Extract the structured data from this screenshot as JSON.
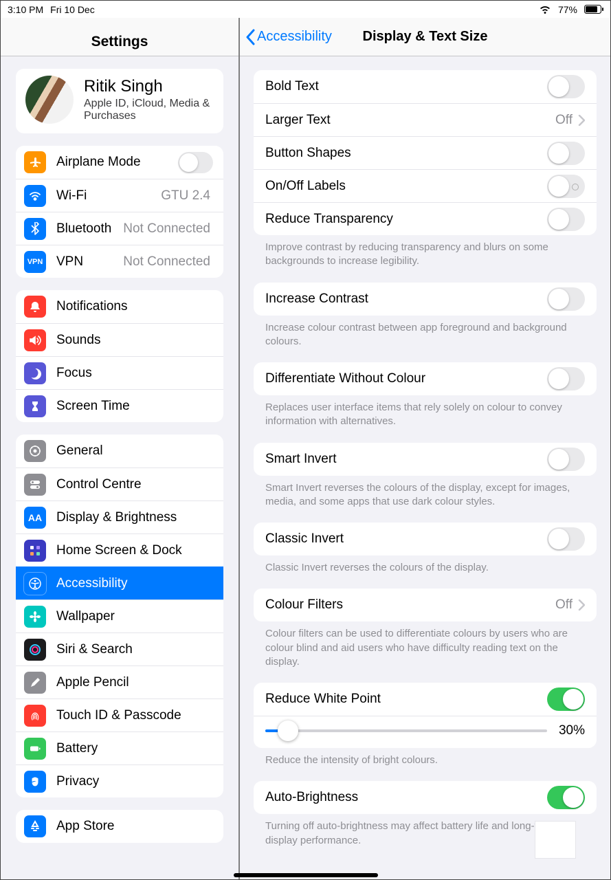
{
  "status": {
    "time": "3:10 PM",
    "date": "Fri 10 Dec",
    "battery": "77%"
  },
  "sidebar": {
    "title": "Settings",
    "user": {
      "name": "Ritik Singh",
      "sub": "Apple ID, iCloud, Media & Purchases"
    },
    "g1": {
      "airplane": "Airplane Mode",
      "wifi": "Wi-Fi",
      "wifi_v": "GTU 2.4",
      "bt": "Bluetooth",
      "bt_v": "Not Connected",
      "vpn": "VPN",
      "vpn_v": "Not Connected"
    },
    "g2": {
      "notif": "Notifications",
      "sounds": "Sounds",
      "focus": "Focus",
      "st": "Screen Time"
    },
    "g3": {
      "general": "General",
      "cc": "Control Centre",
      "db": "Display & Brightness",
      "hs": "Home Screen & Dock",
      "acc": "Accessibility",
      "wp": "Wallpaper",
      "siri": "Siri & Search",
      "pencil": "Apple Pencil",
      "touch": "Touch ID & Passcode",
      "batt": "Battery",
      "priv": "Privacy"
    },
    "g4": {
      "appstore": "App Store"
    }
  },
  "header": {
    "back": "Accessibility",
    "title": "Display & Text Size"
  },
  "s": {
    "bold": "Bold Text",
    "larger": "Larger Text",
    "larger_v": "Off",
    "shapes": "Button Shapes",
    "onoff": "On/Off Labels",
    "reduce_t": "Reduce Transparency",
    "reduce_t_foot": "Improve contrast by reducing transparency and blurs on some backgrounds to increase legibility.",
    "contrast": "Increase Contrast",
    "contrast_foot": "Increase colour contrast between app foreground and background colours.",
    "diff": "Differentiate Without Colour",
    "diff_foot": "Replaces user interface items that rely solely on colour to convey information with alternatives.",
    "smart": "Smart Invert",
    "smart_foot": "Smart Invert reverses the colours of the display, except for images, media, and some apps that use dark colour styles.",
    "classic": "Classic Invert",
    "classic_foot": "Classic Invert reverses the colours of the display.",
    "filters": "Colour Filters",
    "filters_v": "Off",
    "filters_foot": "Colour filters can be used to differentiate colours by users who are colour blind and aid users who have difficulty reading text on the display.",
    "white": "Reduce White Point",
    "white_v": "30%",
    "white_foot": "Reduce the intensity of bright colours.",
    "auto": "Auto-Brightness",
    "auto_foot": "Turning off auto-brightness may affect battery life and long-term display performance."
  }
}
